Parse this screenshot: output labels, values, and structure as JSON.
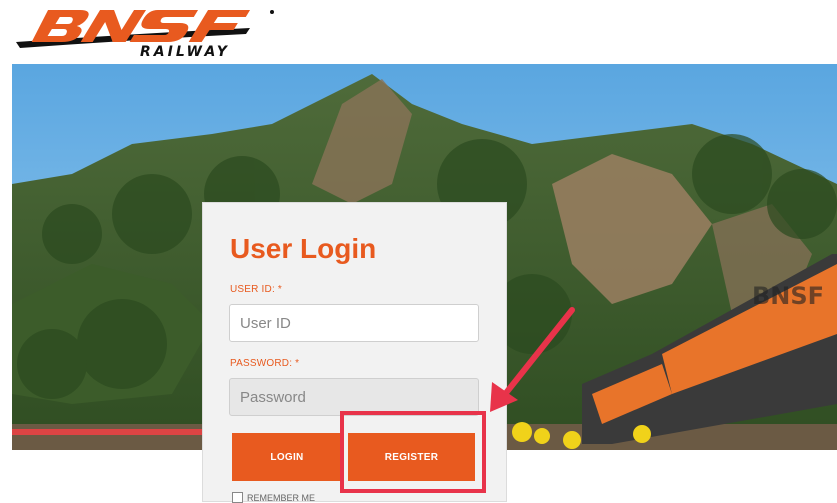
{
  "brand": {
    "logo_text": "BNSF",
    "logo_sub": "RAILWAY",
    "accent": "#e85a1f",
    "annotation_color": "#e8334a"
  },
  "login": {
    "title": "User Login",
    "user_label": "USER ID: *",
    "user_placeholder": "User ID",
    "password_label": "PASSWORD: *",
    "password_placeholder": "Password",
    "login_button": "LOGIN",
    "register_button": "REGISTER",
    "remember_label": "REMEMBER ME"
  }
}
